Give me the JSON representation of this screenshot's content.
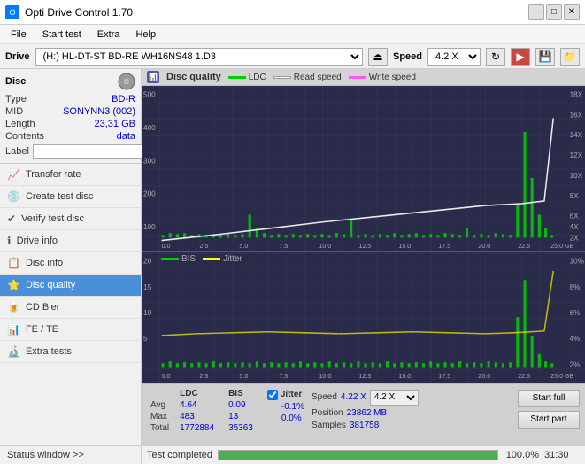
{
  "titlebar": {
    "title": "Opti Drive Control 1.70",
    "minimize": "—",
    "maximize": "□",
    "close": "✕"
  },
  "menubar": {
    "items": [
      "File",
      "Start test",
      "Extra",
      "Help"
    ]
  },
  "drivebar": {
    "label": "Drive",
    "drive_value": "(H:)  HL-DT-ST BD-RE  WH16NS48 1.D3",
    "speed_label": "Speed",
    "speed_value": "4.2 X"
  },
  "disc": {
    "title": "Disc",
    "type_label": "Type",
    "type_value": "BD-R",
    "mid_label": "MID",
    "mid_value": "SONYNN3 (002)",
    "length_label": "Length",
    "length_value": "23,31 GB",
    "contents_label": "Contents",
    "contents_value": "data",
    "label_label": "Label",
    "label_value": ""
  },
  "sidebar_nav": [
    {
      "id": "transfer-rate",
      "label": "Transfer rate",
      "icon": "📈"
    },
    {
      "id": "create-test-disc",
      "label": "Create test disc",
      "icon": "💿"
    },
    {
      "id": "verify-test-disc",
      "label": "Verify test disc",
      "icon": "✔"
    },
    {
      "id": "drive-info",
      "label": "Drive info",
      "icon": "ℹ"
    },
    {
      "id": "disc-info",
      "label": "Disc info",
      "icon": "📋"
    },
    {
      "id": "disc-quality",
      "label": "Disc quality",
      "icon": "⭐",
      "active": true
    },
    {
      "id": "cd-bier",
      "label": "CD Bier",
      "icon": "🍺"
    },
    {
      "id": "fe-te",
      "label": "FE / TE",
      "icon": "📊"
    },
    {
      "id": "extra-tests",
      "label": "Extra tests",
      "icon": "🔬"
    }
  ],
  "status_window": "Status window >>",
  "chart": {
    "title": "Disc quality",
    "legend": [
      {
        "label": "LDC",
        "color": "#00aa00"
      },
      {
        "label": "Read speed",
        "color": "#ffffff"
      },
      {
        "label": "Write speed",
        "color": "#ff55ff"
      }
    ],
    "top_y_left_max": 500,
    "top_y_right_max": 18,
    "top_y_right_label": "X",
    "bottom_legend": [
      {
        "label": "BIS",
        "color": "#00aa00"
      },
      {
        "label": "Jitter",
        "color": "#ffff00"
      }
    ],
    "bottom_y_left_max": 20,
    "bottom_y_right_max": 10
  },
  "stats": {
    "headers": [
      "LDC",
      "BIS"
    ],
    "avg_label": "Avg",
    "avg_ldc": "4.64",
    "avg_bis": "0.09",
    "max_label": "Max",
    "max_ldc": "483",
    "max_bis": "13",
    "total_label": "Total",
    "total_ldc": "1772884",
    "total_bis": "35363",
    "jitter_label": "Jitter",
    "jitter_avg": "-0.1%",
    "jitter_max": "0.0%",
    "speed_label": "Speed",
    "speed_value": "4.22 X",
    "speed_select": "4.2 X",
    "position_label": "Position",
    "position_value": "23862 MB",
    "samples_label": "Samples",
    "samples_value": "381758",
    "btn_start_full": "Start full",
    "btn_start_part": "Start part"
  },
  "progress": {
    "status_text": "Test completed",
    "percent": "100.0%",
    "time": "31:30"
  }
}
